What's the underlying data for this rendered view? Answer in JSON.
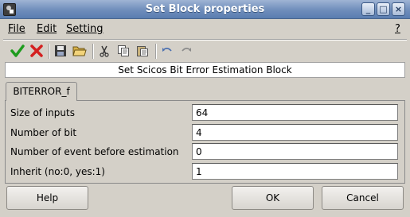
{
  "window": {
    "title": "Set Block properties",
    "controls": {
      "minimize": "_",
      "maximize": "□",
      "close": "×"
    }
  },
  "menubar": {
    "file": "File",
    "edit": "Edit",
    "setting": "Setting",
    "help": "?"
  },
  "toolbar": {
    "icons": [
      "check-icon",
      "cancel-x-icon",
      "save-icon",
      "open-folder-icon",
      "cut-icon",
      "copy-icon",
      "paste-icon",
      "undo-icon",
      "redo-icon"
    ],
    "accent_check": "#1e9c1e",
    "accent_cancel": "#d42020"
  },
  "header": {
    "text": "Set Scicos Bit Error Estimation Block"
  },
  "tab": {
    "label": "BITERROR_f"
  },
  "fields": [
    {
      "label": "Size of inputs",
      "value": "64"
    },
    {
      "label": "Number of bit",
      "value": "4"
    },
    {
      "label": "Number of event before estimation",
      "value": "0"
    },
    {
      "label": "Inherit (no:0, yes:1)",
      "value": "1"
    }
  ],
  "buttons": {
    "help": "Help",
    "ok": "OK",
    "cancel": "Cancel"
  }
}
